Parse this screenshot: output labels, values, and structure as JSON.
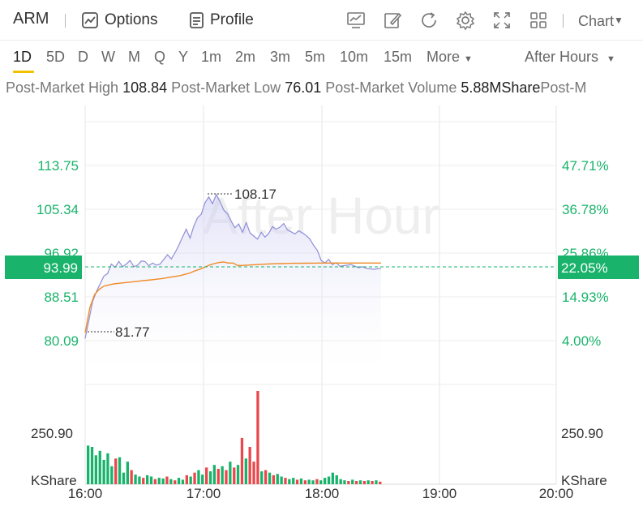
{
  "toolbar": {
    "ticker": "ARM",
    "options_label": "Options",
    "profile_label": "Profile",
    "chart_menu_label": "Chart"
  },
  "periods": [
    "1D",
    "5D",
    "D",
    "W",
    "M",
    "Q",
    "Y",
    "1m",
    "2m",
    "3m",
    "5m",
    "10m",
    "15m",
    "More"
  ],
  "active_period": "1D",
  "session_label": "After Hours",
  "stats": {
    "high_label": "Post-Market High",
    "high_value": "108.84",
    "low_label": "Post-Market Low",
    "low_value": "76.01",
    "volume_label": "Post-Market Volume",
    "volume_value": "5.88MShare",
    "extra_label": "Post-M"
  },
  "watermark": "After Hour",
  "current_price_tag": "93.99",
  "current_pct_tag": "22.05%",
  "annotations": {
    "high": "108.17",
    "low": "81.77"
  },
  "volume_axis": {
    "left_value": "250.90",
    "left_unit": "KShare",
    "right_value": "250.90",
    "right_unit": "KShare"
  },
  "colors": {
    "up": "#18b36b",
    "down": "#e8474b",
    "price_line": "#8e8ed8",
    "avg_line": "#f08a24",
    "tag_bg": "#19b36b",
    "highlight": "#f2c200"
  },
  "chart_data": {
    "type": "line",
    "x_ticks": [
      "16:00",
      "17:00",
      "18:00",
      "19:00",
      "20:00"
    ],
    "y_ticks_left": [
      "113.75",
      "105.34",
      "96.92",
      "88.51",
      "80.09"
    ],
    "y_ticks_right": [
      "47.71%",
      "36.78%",
      "25.86%",
      "14.93%",
      "4.00%"
    ],
    "ylim": [
      80.09,
      113.75
    ],
    "series": [
      {
        "values": [
          80.5,
          84.0,
          87.6,
          89.5,
          91.0,
          92.5,
          93.0,
          94.8,
          94.2,
          95.3,
          94.3,
          94.8,
          95.5,
          94.3,
          94.6,
          95.4,
          95.3,
          94.5,
          95.0,
          94.6,
          94.8,
          95.7,
          96.6,
          95.8,
          97.0,
          98.4,
          100.0,
          101.5,
          99.8,
          102.1,
          103.7,
          104.4,
          106.6,
          107.7,
          106.4,
          108.17,
          106.8,
          105.2,
          104.5,
          103.0,
          101.8,
          102.5,
          100.9,
          102.8,
          100.8,
          100.2,
          99.6,
          100.9,
          100.0,
          100.7,
          102.0,
          101.5,
          101.9,
          102.6,
          101.4,
          101.0,
          100.6,
          101.2,
          100.8,
          100.3,
          99.6,
          98.4,
          97.4,
          95.5,
          95.0,
          95.7,
          94.7,
          95.1,
          94.4,
          94.5,
          94.6,
          94.7,
          94.4,
          94.1,
          94.3,
          94.0,
          93.9,
          93.8,
          93.9,
          93.99
        ]
      },
      {
        "values": [
          81.6,
          86.5,
          89.0,
          90.0,
          90.6,
          90.8,
          91.0,
          91.1,
          91.2,
          91.3,
          91.4,
          91.5,
          91.6,
          91.7,
          91.8,
          91.9,
          92.0,
          92.15,
          92.3,
          92.45,
          92.6,
          92.85,
          93.1,
          93.5,
          93.8,
          94.2,
          94.6,
          94.9,
          95.1,
          95.2,
          95.0,
          95.0,
          94.5,
          94.55,
          94.6,
          94.65,
          94.7,
          94.75,
          94.8,
          94.85,
          94.88,
          94.9,
          94.92,
          94.94,
          94.95,
          94.96,
          94.97,
          94.98,
          94.99,
          95.0,
          95.0,
          95.0,
          95.0,
          95.0,
          95.0,
          95.0,
          95.0,
          95.0,
          95.0,
          95.0,
          95.0,
          95.0,
          95.0
        ]
      }
    ],
    "volume_bars": [
      {
        "v": 60,
        "up": true
      },
      {
        "v": 58,
        "up": true
      },
      {
        "v": 45,
        "up": true
      },
      {
        "v": 52,
        "up": true
      },
      {
        "v": 38,
        "up": true
      },
      {
        "v": 48,
        "up": true
      },
      {
        "v": 28,
        "up": true
      },
      {
        "v": 40,
        "up": false
      },
      {
        "v": 42,
        "up": true
      },
      {
        "v": 18,
        "up": true
      },
      {
        "v": 35,
        "up": true
      },
      {
        "v": 22,
        "up": false
      },
      {
        "v": 15,
        "up": true
      },
      {
        "v": 12,
        "up": true
      },
      {
        "v": 10,
        "up": false
      },
      {
        "v": 14,
        "up": true
      },
      {
        "v": 12,
        "up": true
      },
      {
        "v": 8,
        "up": false
      },
      {
        "v": 10,
        "up": true
      },
      {
        "v": 9,
        "up": true
      },
      {
        "v": 12,
        "up": false
      },
      {
        "v": 8,
        "up": true
      },
      {
        "v": 6,
        "up": false
      },
      {
        "v": 10,
        "up": true
      },
      {
        "v": 7,
        "up": true
      },
      {
        "v": 14,
        "up": false
      },
      {
        "v": 12,
        "up": true
      },
      {
        "v": 18,
        "up": false
      },
      {
        "v": 22,
        "up": true
      },
      {
        "v": 15,
        "up": true
      },
      {
        "v": 26,
        "up": false
      },
      {
        "v": 20,
        "up": true
      },
      {
        "v": 30,
        "up": true
      },
      {
        "v": 24,
        "up": false
      },
      {
        "v": 28,
        "up": true
      },
      {
        "v": 22,
        "up": false
      },
      {
        "v": 35,
        "up": true
      },
      {
        "v": 26,
        "up": false
      },
      {
        "v": 30,
        "up": true
      },
      {
        "v": 72,
        "up": false
      },
      {
        "v": 40,
        "up": true
      },
      {
        "v": 58,
        "up": false
      },
      {
        "v": 35,
        "up": false
      },
      {
        "v": 145,
        "up": false
      },
      {
        "v": 20,
        "up": true
      },
      {
        "v": 22,
        "up": false
      },
      {
        "v": 18,
        "up": true
      },
      {
        "v": 14,
        "up": false
      },
      {
        "v": 16,
        "up": true
      },
      {
        "v": 12,
        "up": true
      },
      {
        "v": 10,
        "up": false
      },
      {
        "v": 8,
        "up": true
      },
      {
        "v": 10,
        "up": true
      },
      {
        "v": 7,
        "up": false
      },
      {
        "v": 9,
        "up": true
      },
      {
        "v": 6,
        "up": false
      },
      {
        "v": 7,
        "up": true
      },
      {
        "v": 6,
        "up": true
      },
      {
        "v": 8,
        "up": false
      },
      {
        "v": 6,
        "up": true
      },
      {
        "v": 10,
        "up": true
      },
      {
        "v": 12,
        "up": true
      },
      {
        "v": 18,
        "up": true
      },
      {
        "v": 14,
        "up": true
      },
      {
        "v": 8,
        "up": true
      },
      {
        "v": 6,
        "up": true
      },
      {
        "v": 5,
        "up": false
      },
      {
        "v": 7,
        "up": true
      },
      {
        "v": 5,
        "up": false
      },
      {
        "v": 6,
        "up": true
      },
      {
        "v": 5,
        "up": false
      },
      {
        "v": 6,
        "up": true
      },
      {
        "v": 5,
        "up": false
      },
      {
        "v": 6,
        "up": true
      },
      {
        "v": 4,
        "up": false
      }
    ]
  }
}
